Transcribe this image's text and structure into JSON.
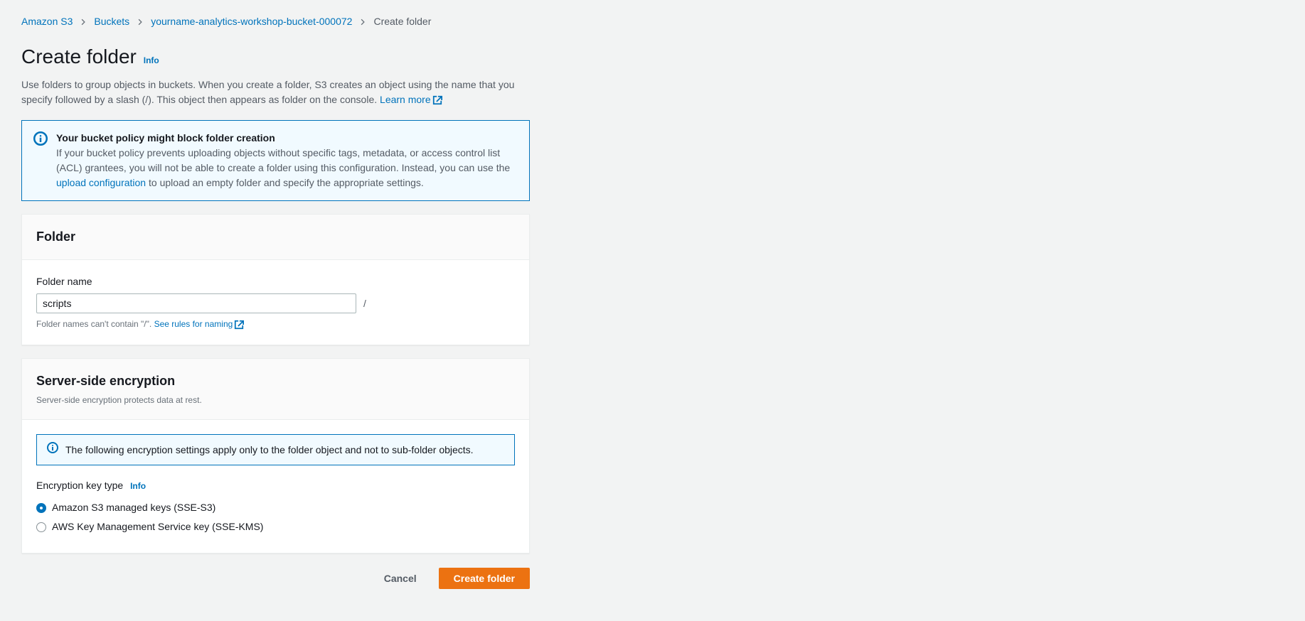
{
  "breadcrumb": {
    "items": [
      {
        "label": "Amazon S3"
      },
      {
        "label": "Buckets"
      },
      {
        "label": "yourname-analytics-workshop-bucket-000072"
      }
    ],
    "current": "Create folder"
  },
  "header": {
    "title": "Create folder",
    "info": "Info",
    "description_part1": "Use folders to group objects in buckets. When you create a folder, S3 creates an object using the name that you specify followed by a slash (/). This object then appears as folder on the console. ",
    "learn_more": "Learn more"
  },
  "policy_alert": {
    "title": "Your bucket policy might block folder creation",
    "body_part1": "If your bucket policy prevents uploading objects without specific tags, metadata, or access control list (ACL) grantees, you will not be able to create a folder using this configuration. Instead, you can use the ",
    "link": "upload configuration",
    "body_part2": " to upload an empty folder and specify the appropriate settings."
  },
  "folder_panel": {
    "title": "Folder",
    "name_label": "Folder name",
    "name_value": "scripts",
    "slash": "/",
    "hint_part1": "Folder names can't contain \"/\". ",
    "hint_link": "See rules for naming"
  },
  "encryption_panel": {
    "title": "Server-side encryption",
    "subtitle": "Server-side encryption protects data at rest.",
    "inline_alert": "The following encryption settings apply only to the folder object and not to sub-folder objects.",
    "key_type_label": "Encryption key type",
    "info": "Info",
    "options": [
      {
        "label": "Amazon S3 managed keys (SSE-S3)",
        "checked": true
      },
      {
        "label": "AWS Key Management Service key (SSE-KMS)",
        "checked": false
      }
    ]
  },
  "actions": {
    "cancel": "Cancel",
    "create": "Create folder"
  }
}
